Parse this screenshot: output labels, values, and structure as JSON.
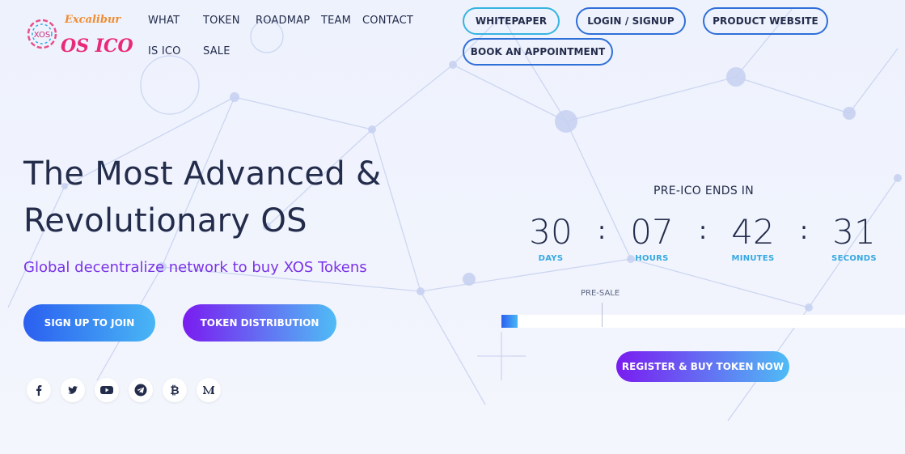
{
  "logo": {
    "top_text": "Excalibur",
    "main_text": "OS ICO",
    "badge_text": "XOS"
  },
  "nav": {
    "what_is_ico_line1": "WHAT",
    "what_is_ico_line2": "IS ICO",
    "token_sale_line1": "TOKEN",
    "token_sale_line2": "SALE",
    "roadmap": "ROADMAP",
    "team": "TEAM",
    "contact": "CONTACT"
  },
  "header_buttons": {
    "whitepaper": "WHITEPAPER",
    "login": "LOGIN / SIGNUP",
    "product": "PRODUCT WEBSITE",
    "appointment": "BOOK AN APPOINTMENT"
  },
  "hero": {
    "title_line1": "The Most Advanced &",
    "title_line2": "Revolutionary OS",
    "subtitle": "Global decentralize network to buy XOS Tokens",
    "signup_label": "SIGN UP TO JOIN",
    "distribution_label": "TOKEN DISTRIBUTION"
  },
  "social_icons": [
    "facebook-icon",
    "twitter-icon",
    "youtube-icon",
    "telegram-icon",
    "bitcoin-icon",
    "medium-icon"
  ],
  "countdown": {
    "heading": "PRE-ICO ENDS IN",
    "days": "30",
    "days_label": "DAYS",
    "hours": "07",
    "hours_label": "HOURS",
    "minutes": "42",
    "minutes_label": "MINUTES",
    "seconds": "31",
    "seconds_label": "SECONDS",
    "separator": ":"
  },
  "progress": {
    "presale_label": "PRE-SALE",
    "fill_fraction": 0.04
  },
  "register_label": "REGISTER & BUY TOKEN NOW",
  "colors": {
    "accent_blue": "#2f6fd8",
    "accent_cyan": "#36b4e0",
    "accent_purple": "#7a33e8",
    "text_dark": "#232c4b"
  }
}
